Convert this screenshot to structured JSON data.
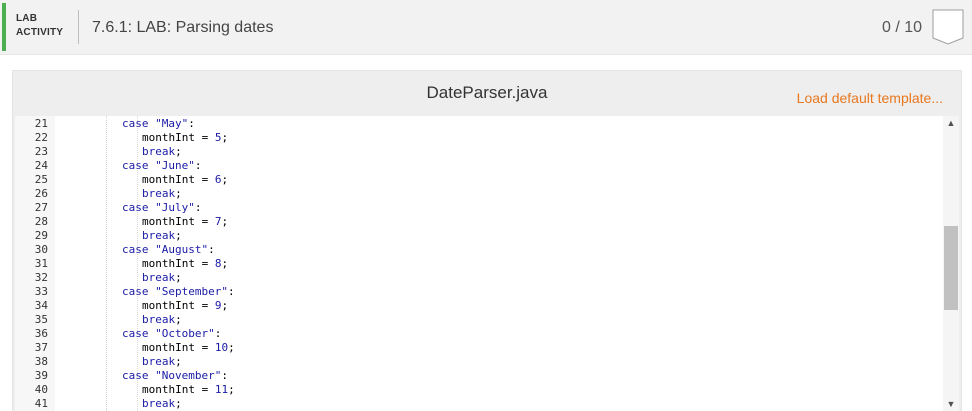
{
  "header": {
    "tag_line1": "LAB",
    "tag_line2": "ACTIVITY",
    "title": "7.6.1: LAB: Parsing dates",
    "score": "0 / 10",
    "accent_color": "#4caf50"
  },
  "panel": {
    "file_name": "DateParser.java",
    "load_label": "Load default template...",
    "link_color": "#e8771f"
  },
  "editor": {
    "lines": [
      {
        "n": "21",
        "kw": "case",
        "str": "\"May\"",
        "rest": ":"
      },
      {
        "n": "22",
        "ident": "monthInt",
        "op": " = ",
        "num": "5",
        "end": ";"
      },
      {
        "n": "23",
        "kw": "break",
        "rest": ";"
      },
      {
        "n": "24",
        "kw": "case",
        "str": "\"June\"",
        "rest": ":"
      },
      {
        "n": "25",
        "ident": "monthInt",
        "op": " = ",
        "num": "6",
        "end": ";"
      },
      {
        "n": "26",
        "kw": "break",
        "rest": ";"
      },
      {
        "n": "27",
        "kw": "case",
        "str": "\"July\"",
        "rest": ":"
      },
      {
        "n": "28",
        "ident": "monthInt",
        "op": " = ",
        "num": "7",
        "end": ";"
      },
      {
        "n": "29",
        "kw": "break",
        "rest": ";"
      },
      {
        "n": "30",
        "kw": "case",
        "str": "\"August\"",
        "rest": ":"
      },
      {
        "n": "31",
        "ident": "monthInt",
        "op": " = ",
        "num": "8",
        "end": ";"
      },
      {
        "n": "32",
        "kw": "break",
        "rest": ";"
      },
      {
        "n": "33",
        "kw": "case",
        "str": "\"September\"",
        "rest": ":"
      },
      {
        "n": "34",
        "ident": "monthInt",
        "op": " = ",
        "num": "9",
        "end": ";"
      },
      {
        "n": "35",
        "kw": "break",
        "rest": ";"
      },
      {
        "n": "36",
        "kw": "case",
        "str": "\"October\"",
        "rest": ":"
      },
      {
        "n": "37",
        "ident": "monthInt",
        "op": " = ",
        "num": "10",
        "end": ";"
      },
      {
        "n": "38",
        "kw": "break",
        "rest": ";"
      },
      {
        "n": "39",
        "kw": "case",
        "str": "\"November\"",
        "rest": ":"
      },
      {
        "n": "40",
        "ident": "monthInt",
        "op": " = ",
        "num": "11",
        "end": ";"
      },
      {
        "n": "41",
        "kw": "break",
        "rest": ";"
      }
    ],
    "scroll_up_icon": "▲",
    "scroll_down_icon": "▼"
  }
}
